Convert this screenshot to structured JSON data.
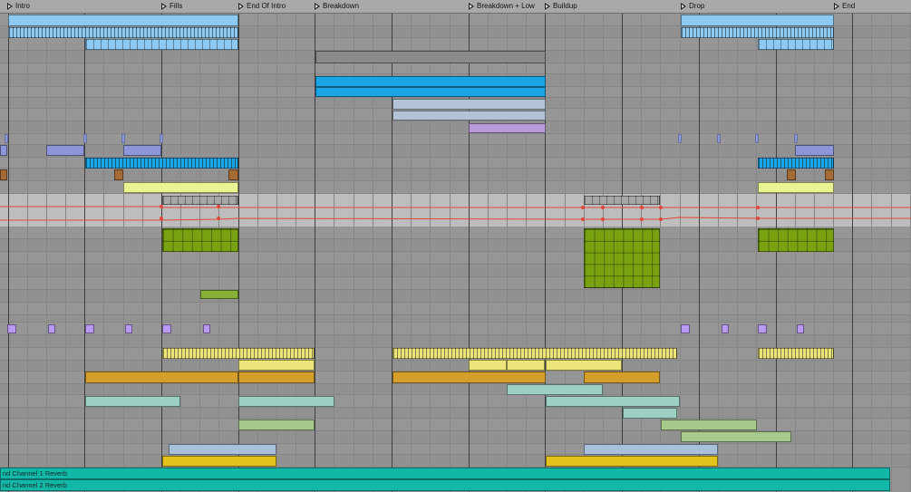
{
  "colors": {
    "background": "#949494",
    "ruler": "#a9a9a9",
    "grid_beat": "#878787",
    "grid_bar": "#3f3f3f",
    "automation": "#e2483a",
    "return_track": "#12b8a7",
    "clip_light_blue": "#8ec9f2",
    "clip_blue": "#19a5e6",
    "clip_pale_blue": "#b4c4d6",
    "clip_lavender": "#b79ad8",
    "clip_periwinkle": "#8c96d8",
    "clip_brown": "#a56b34",
    "clip_pale_yellow": "#e9f590",
    "clip_olive": "#7aa10f",
    "clip_green": "#86b037",
    "clip_violet": "#b89af0",
    "clip_yellow": "#ece57a",
    "clip_orange": "#d39f2a",
    "clip_teal": "#9dd0c2",
    "clip_sage": "#a7c98c",
    "clip_steel": "#a9c0da",
    "clip_gold": "#e2c21b"
  },
  "locators": [
    {
      "label": "Intro"
    },
    {
      "label": "Fills"
    },
    {
      "label": "End Of Intro"
    },
    {
      "label": "Breakdown"
    },
    {
      "label": "Breakdown + Low"
    },
    {
      "label": "Buildup"
    },
    {
      "label": "Drop"
    },
    {
      "label": "End"
    }
  ],
  "return_tracks": [
    {
      "label": "nd Channel 1 Reverb"
    },
    {
      "label": "nd Channel 2 Reverb"
    }
  ]
}
